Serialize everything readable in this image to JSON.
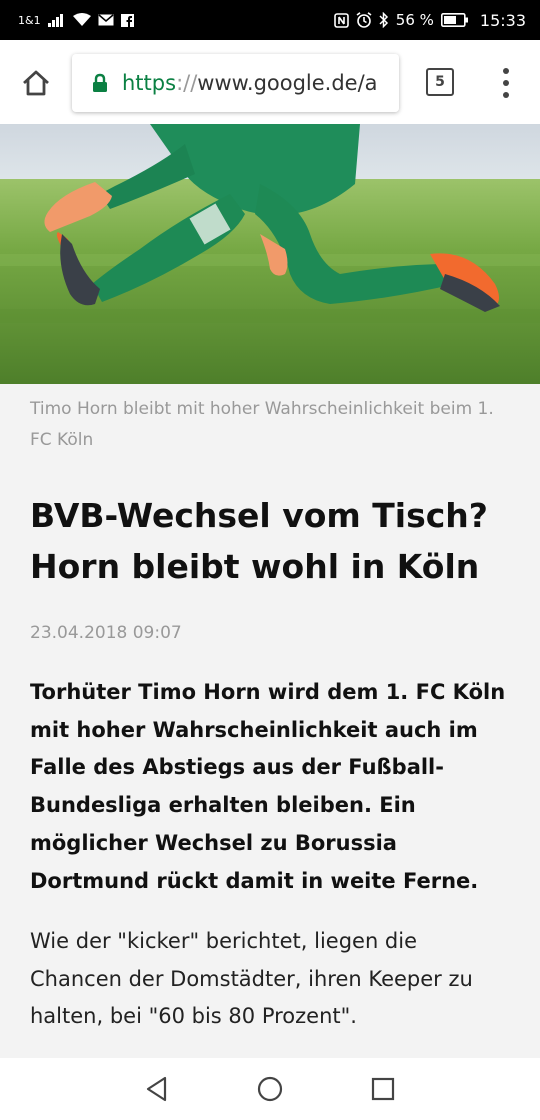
{
  "status_bar": {
    "carrier": "1&1",
    "battery_pct": "56 %",
    "time": "15:33",
    "icons": [
      "signal-icon",
      "wifi-icon",
      "mail-icon",
      "facebook-icon",
      "nfc-icon",
      "alarm-icon",
      "bluetooth-icon",
      "battery-icon"
    ]
  },
  "browser": {
    "url_scheme": "https",
    "url_sep": "://",
    "url_host": "www.google.de/a",
    "tab_count": "5",
    "secure": true,
    "accent_color": "#0b8043"
  },
  "article": {
    "image_caption": "Timo Horn bleibt mit hoher Wahrscheinlichkeit beim 1. FC Köln",
    "headline": "BVB-Wechsel vom Tisch? Horn bleibt wohl in Köln",
    "date": "23.04.2018 09:07",
    "lead": "Torhüter Timo Horn wird dem 1. FC Köln mit hoher Wahrscheinlichkeit auch im Falle des Abstiegs aus der Fußball-Bundesliga erhalten bleiben. Ein möglicher Wechsel zu Borussia Dortmund rückt damit in weite Ferne.",
    "body": "Wie der \"kicker\" berichtet, liegen die Chancen der Domstädter, ihren Keeper zu halten, bei \"60 bis 80 Prozent\"."
  },
  "nav": {
    "buttons": [
      "back-icon",
      "home-icon",
      "recents-icon"
    ]
  }
}
